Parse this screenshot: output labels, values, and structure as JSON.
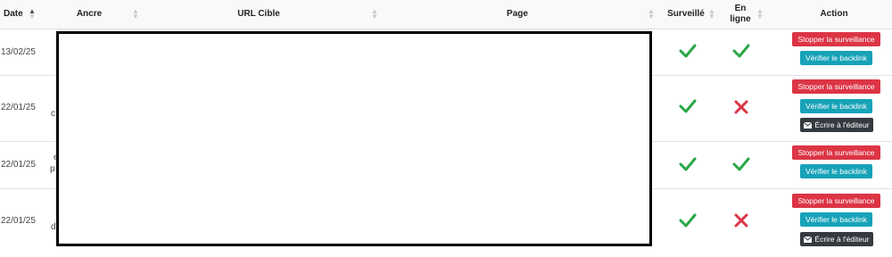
{
  "table": {
    "headers": {
      "date": "Date",
      "ancre": "Ancre",
      "url_cible": "URL Cible",
      "page": "Page",
      "surveille": "Surveillé",
      "en_ligne_1": "En",
      "en_ligne_2": "ligne",
      "action": "Action"
    },
    "rows": [
      {
        "date": "13/02/25",
        "ancre_fragment": "",
        "surveille": "check",
        "en_ligne": "check",
        "actions": [
          "Stopper la surveillance",
          "Vérifier le backlink"
        ]
      },
      {
        "date": "22/01/25",
        "ancre_fragment": "c",
        "surveille": "check",
        "en_ligne": "cross",
        "actions": [
          "Stopper la surveillance",
          "Vérifier le backlink",
          "Écrire à l'éditeur"
        ]
      },
      {
        "date": "22/01/25",
        "ancre_fragment_1": "e",
        "ancre_fragment_2": "p",
        "surveille": "check",
        "en_ligne": "check",
        "actions": [
          "Stopper la surveillance",
          "Vérifier le backlink"
        ]
      },
      {
        "date": "22/01/25",
        "ancre_fragment": "d",
        "surveille": "check",
        "en_ligne": "cross",
        "actions": [
          "Stopper la surveillance",
          "Vérifier le backlink",
          "Écrire à l'éditeur"
        ]
      }
    ]
  },
  "colors": {
    "check": "#28a745",
    "cross": "#dc3545",
    "stop_button": "#dc3545",
    "verify_button": "#17a2b8",
    "write_button": "#343a40"
  },
  "icons": {
    "check": "check-icon",
    "cross": "cross-icon",
    "envelope": "envelope-icon",
    "sort": "sort-icon"
  }
}
